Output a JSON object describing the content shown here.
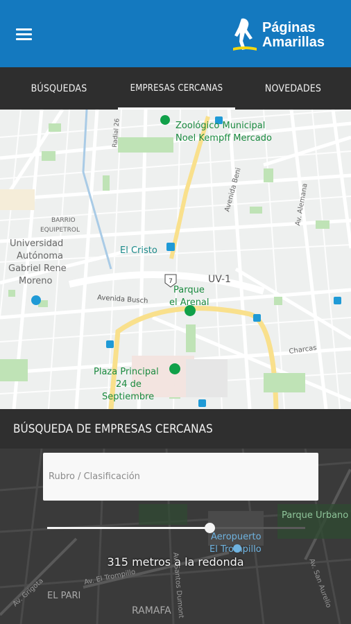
{
  "header": {
    "menu_icon": "hamburger-menu-icon",
    "logo_icon": "walking-fingers-logo-icon",
    "logo_line1": "Páginas",
    "logo_line2": "Amarillas",
    "bg_color": "#1479bf",
    "logo_accent": "#f5d80f"
  },
  "tabs": [
    {
      "label": "BÚSQUEDAS",
      "active": false
    },
    {
      "label": "EMPRESAS CERCANAS",
      "active": true
    },
    {
      "label": "NOVEDADES",
      "active": false
    }
  ],
  "map": {
    "labels": {
      "zoo_line1": "Zoológico Municipal",
      "zoo_line2": "Noel Kempff Mercado",
      "radial": "Radial 26",
      "barrio_line1": "BARRIO",
      "barrio_line2": "EQUIPETROL",
      "univ_line1": "Universidad",
      "univ_line2": "Autónoma",
      "univ_line3": "Gabriel Rene",
      "univ_line4": "Moreno",
      "el_cristo": "El Cristo",
      "avenida_beni": "Avenida Beni",
      "av_alemana": "Av. Alemana",
      "uv1": "UV-1",
      "route_number": "7",
      "parque_line1": "Parque",
      "parque_line2": "el Arenal",
      "avenida_busch": "Avenida Busch",
      "charcas": "Charcas",
      "plaza_line1": "Plaza Principal",
      "plaza_line2": "24 de",
      "plaza_line3": "Septiembre"
    }
  },
  "panel": {
    "title": "BÚSQUEDA DE EMPRESAS CERCANAS",
    "search_placeholder": "Rubro / Clasificación",
    "radius_text": "315 metros a la redonda",
    "slider_fraction": 0.63
  },
  "bottom_map": {
    "labels": {
      "parque_urbano": "Parque Urbano",
      "aeropuerto_line1": "Aeropuerto",
      "aeropuerto_line2": "El Trompillo",
      "av_grigota": "Av. Grigota",
      "el_pari": "EL PARI",
      "av_el_trompillo": "Av. El Trompillo",
      "ramafa": "RAMAFA",
      "av_san_aurelio": "Av. San Aurelio",
      "santos_dumont": "Av. Santos Dumont"
    }
  }
}
